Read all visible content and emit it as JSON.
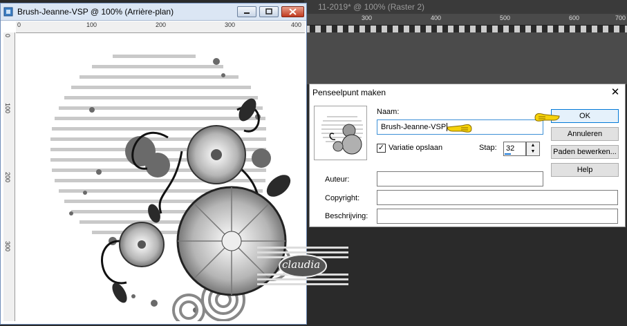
{
  "background_window": {
    "title": "11-2019* @ 100% (Raster 2)",
    "ruler_ticks": [
      "300",
      "400",
      "500",
      "600",
      "700"
    ]
  },
  "image_window": {
    "title": "Brush-Jeanne-VSP @ 100% (Arrière-plan)",
    "ruler_top_ticks": [
      "0",
      "100",
      "200",
      "300",
      "400"
    ],
    "ruler_left_ticks": [
      "0",
      "100",
      "200",
      "300"
    ]
  },
  "dialog": {
    "title": "Penseelpunt maken",
    "close_glyph": "✕",
    "name_label": "Naam:",
    "name_value": "Brush-Jeanne-VSP",
    "variation_label": "Variatie opslaan",
    "variation_checked": true,
    "variation_check_glyph": "✓",
    "step_label": "Stap:",
    "step_value": "32",
    "spin_up_glyph": "▲",
    "spin_down_glyph": "▼",
    "author_label": "Auteur:",
    "author_value": "",
    "copyright_label": "Copyright:",
    "copyright_value": "",
    "description_label": "Beschrijving:",
    "description_value": "",
    "buttons": {
      "ok": "OK",
      "cancel": "Annuleren",
      "edit_paths": "Paden bewerken...",
      "help": "Help"
    }
  },
  "watermark": {
    "text": "claudia"
  },
  "colors": {
    "accent": "#0078d7",
    "hand_pointer": "#f5d10a",
    "titlebar": "#dbe6f4"
  },
  "icons": [
    "psp-doc-icon",
    "minimize-icon",
    "maximize-icon",
    "close-icon",
    "hand-pointer-icon",
    "checkbox-check-icon",
    "spin-up-icon",
    "spin-down-icon"
  ]
}
